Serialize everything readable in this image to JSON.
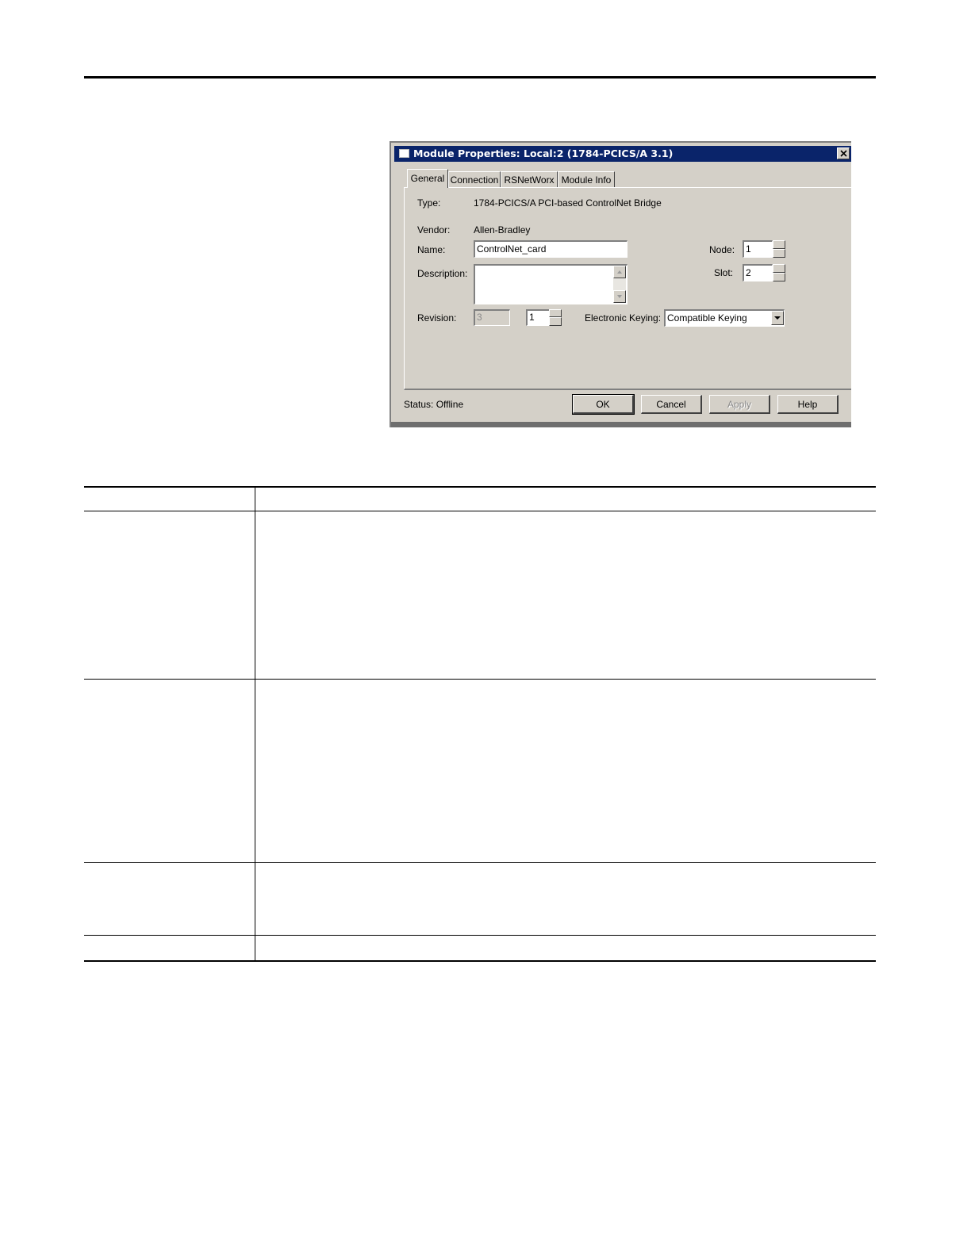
{
  "dialog": {
    "title": "Module Properties: Local:2 (1784-PCICS/A 3.1)",
    "tabs": [
      {
        "label": "General",
        "active": true
      },
      {
        "label": "Connection",
        "active": false
      },
      {
        "label": "RSNetWorx",
        "active": false
      },
      {
        "label": "Module Info",
        "active": false
      }
    ],
    "type_label": "Type:",
    "type_value": "1784-PCICS/A PCI-based ControlNet Bridge",
    "vendor_label": "Vendor:",
    "vendor_value": "Allen-Bradley",
    "name_label": "Name:",
    "name_value": "ControlNet_card",
    "description_label": "Description:",
    "description_value": "",
    "node_label": "Node:",
    "node_value": "1",
    "slot_label": "Slot:",
    "slot_value": "2",
    "revision_label": "Revision:",
    "revision_major": "3",
    "revision_minor": "1",
    "keying_label": "Electronic Keying:",
    "keying_value": "Compatible Keying",
    "status_text": "Status:  Offline",
    "buttons": {
      "ok": "OK",
      "cancel": "Cancel",
      "apply": "Apply",
      "help": "Help"
    }
  }
}
